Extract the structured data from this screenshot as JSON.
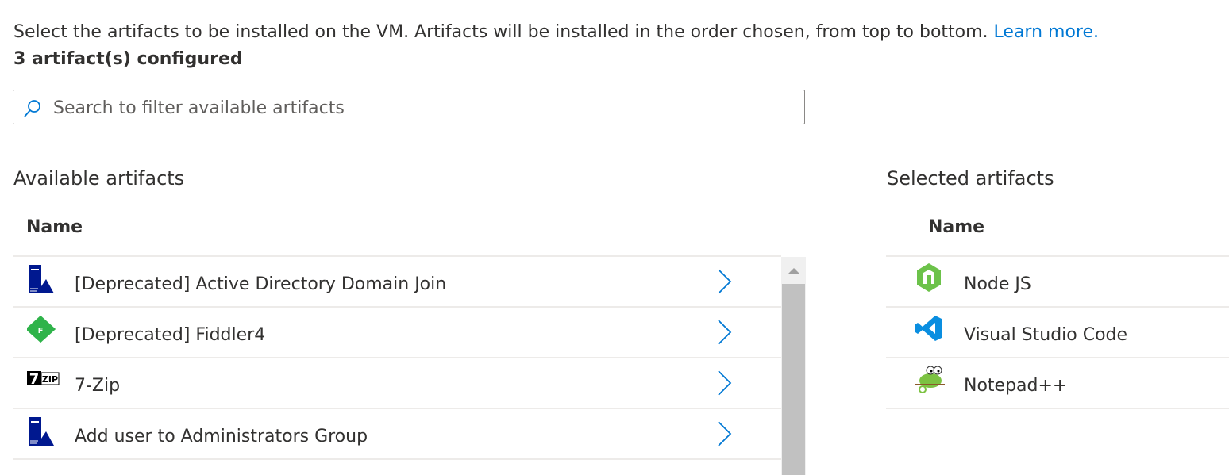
{
  "intro": {
    "text": "Select the artifacts to be installed on the VM. Artifacts will be installed in the order chosen, from top to bottom. ",
    "link": "Learn more."
  },
  "count": "3 artifact(s) configured",
  "search": {
    "placeholder": "Search to filter available artifacts",
    "value": ""
  },
  "available": {
    "title": "Available artifacts",
    "column": "Name",
    "items": [
      {
        "label": "[Deprecated] Active Directory Domain Join",
        "icon": "server-icon"
      },
      {
        "label": "[Deprecated] Fiddler4",
        "icon": "fiddler-icon"
      },
      {
        "label": "7-Zip",
        "icon": "7zip-icon"
      },
      {
        "label": "Add user to Administrators Group",
        "icon": "server-icon"
      }
    ]
  },
  "selected": {
    "title": "Selected artifacts",
    "column": "Name",
    "items": [
      {
        "label": "Node JS",
        "icon": "nodejs-icon"
      },
      {
        "label": "Visual Studio Code",
        "icon": "vscode-icon"
      },
      {
        "label": "Notepad++",
        "icon": "notepadpp-icon"
      }
    ]
  },
  "colors": {
    "link": "#0078d4",
    "server": "#00188f",
    "fiddler": "#2fb34a",
    "node": "#6cc24a",
    "vscode": "#0078d4"
  }
}
